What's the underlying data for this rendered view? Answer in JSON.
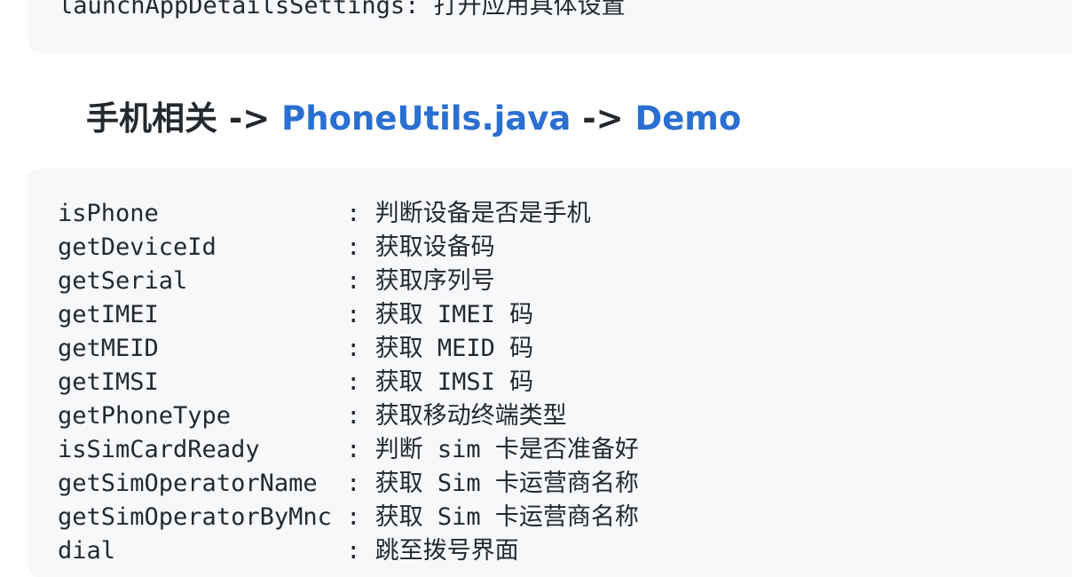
{
  "top_code": {
    "line": "launchAppDetailsSettings: 打开应用具体设置"
  },
  "heading": {
    "prefix": "手机相关 ",
    "arrow1": "-> ",
    "link1": "PhoneUtils.java",
    "arrow2": " -> ",
    "link2": "Demo"
  },
  "code": {
    "lines": [
      "isPhone             : 判断设备是否是手机",
      "getDeviceId         : 获取设备码",
      "getSerial           : 获取序列号",
      "getIMEI             : 获取 IMEI 码",
      "getMEID             : 获取 MEID 码",
      "getIMSI             : 获取 IMSI 码",
      "getPhoneType        : 获取移动终端类型",
      "isSimCardReady      : 判断 sim 卡是否准备好",
      "getSimOperatorName  : 获取 Sim 卡运营商名称",
      "getSimOperatorByMnc : 获取 Sim 卡运营商名称",
      "dial                : 跳至拨号界面"
    ]
  },
  "colors": {
    "link": "#2a6fd1",
    "text": "#24292e",
    "code_background": "#f6f8fa"
  }
}
